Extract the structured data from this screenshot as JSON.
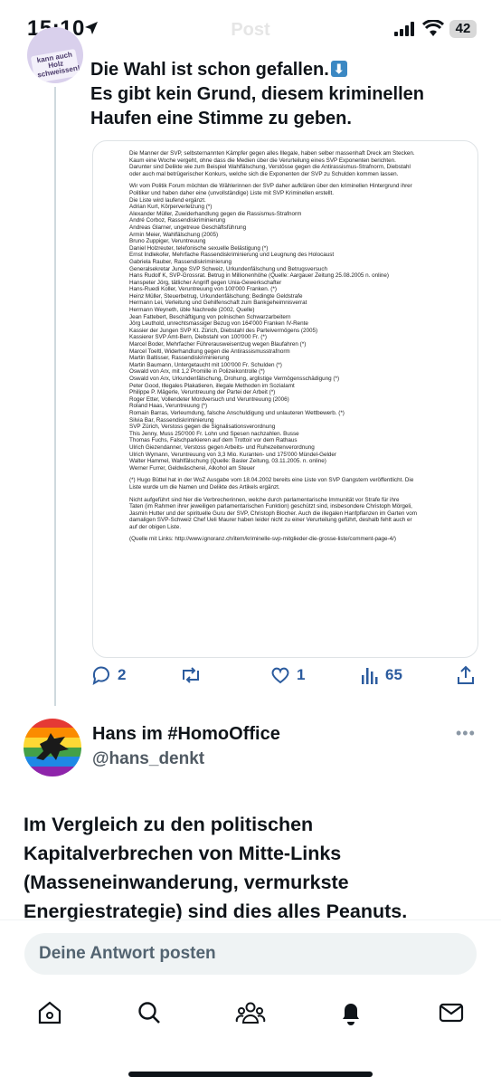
{
  "status_bar": {
    "time": "15:10",
    "battery": "42",
    "ghost_title": "Post"
  },
  "tweet": {
    "avatar_text": "kann auch Holz schweissen!",
    "lines": [
      "Die Wahl ist schon gefallen.",
      "Es gibt kein Grund, diesem kriminellen",
      "Haufen eine Stimme zu geben."
    ],
    "emoji": "⬇",
    "doc_lines": [
      "Die Manner der SVP, selbsternannten Kämpfer gegen alles Illegale, haben selber massenhaft Dreck am Stecken.",
      "Kaum eine Woche vergeht, ohne dass die Medien über die Verurteilung eines SVP Exponenten berichten.",
      "Darunter sind Delikte wie zum Beispiel Wahlfälschung, Verstösse gegen die Antirassismus-Strafnorm, Diebstahl",
      "oder auch mal betrügerischer Konkurs, welche sich die Exponenten der SVP zu Schulden kommen lassen.",
      "",
      "Wir vom Politik Forum möchten die Wählerinnen der SVP daher aufklären über den kriminellen Hintergrund ihrer",
      "Politiker und haben daher eine (unvollständige) Liste mit SVP Kriminellen erstellt.",
      "Die Liste wird laufend ergänzt.",
      "Adrian Kurt, Körperverletzung (*)",
      "Alexander Müller, Zuwiderhandlung gegen die Rassismus-Strafnorm",
      "André Corboz, Rassendiskriminierung",
      "Andreas Glarner, ungetreue Geschäftsführung",
      "Armin Meier, Wahlfälschung (2005)",
      "Bruno Zuppiger, Veruntreuung",
      "Daniel Holzreuter, telefonische sexuelle Belästigung (*)",
      "Ernst Indlekofer, Mehrfache Rassendiskriminierung und Leugnung des Holocaust",
      "Gabriela Rauber, Rassendiskriminierung",
      "Generalsekretar Junge SVP Schweiz, Urkundenfälschung und Betrugsversuch",
      "Hans Rudolf K, SVP-Grossrat. Betrug in Millionenhöhe (Quelle: Aargauer Zeitung 25.08.2005 n. online)",
      "Hanspeter Jörg, tätlicher Angriff gegen Unia-Gewerkschafter",
      "Hans-Ruedi Koller, Veruntreuung von 100'000 Franken. (*)",
      "Heinz Müller, Steuerbetrug, Urkundenfälschung; Bedingte Geldstrafe",
      "Hermann Lei, Verleitung und Gehilfenschaft zum Bankgeheimnisverrat",
      "Hermann Weyneth, üble Nachrede (2002, Quelle)",
      "Jean Fattebert, Beschäftigung von polnischen Schwarzarbeitern",
      "Jörg Leuthold, unrechtsmassiger Bezug von 164'000 Franken IV-Rente",
      "Kassier der Jungen SVP Kt. Zürich, Diebstahl des Parteivermögens (2005)",
      "Kassierer SVP Amt-Bern, Diebstahl von 100'000 Fr. (*)",
      "Marcel Boder, Mehrfacher Führerausweisentzug wegen Blaufahren (*)",
      "Marcel Toeltl, Widerhandlung gegen die Antirassismusstrafnorm",
      "Martin Baltisser, Rassendiskriminierung",
      "Martin Baumann, Untergetaucht mit 100'000 Fr. Schulden (*)",
      "Oswald von Arx, mit 1,2 Promille in Polizeikontrolle (*)",
      "Oswald von Arx, Urkundenfälschung, Drohung, arglistige Vermögensschädigung (*)",
      "Peter Good, Illegales Plakatieren, illegale Methoden im Sozialamt",
      "Philippe P. Mägerle, Veruntreuung der Partei der Arbeit (*)",
      "Roger Etter, Vollendeter Mordversuch und Veruntreuung (2006)",
      "Roland Haas, Veruntreuung (*)",
      "Romain Barras, Verleumdung, falsche Anschuldigung und unlauteren Wettbewerb. (*)",
      "Silvia Bar, Rassendiskriminierung",
      "SVP Zürich, Verstoss gegen die Signalisationsverordnung",
      "This Jenny, Muss 250'000 Fr. Lohn und Spesen nachzahlen. Busse",
      "Thomas Fuchs, Falschparkieren auf dem Trottoir vor dem Rathaus",
      "Ulrich Giezendanner, Verstoss gegen Arbeits- und Ruhezeitenverordnung",
      "Ulrich Wymann, Veruntreuung von 3,3 Mio. Kuranten- und 175'000 Mündel-Gelder",
      "Walter Hammel, Wahlfälschung (Quelle: Basler Zeitung, 03.11.2005. n. online)",
      "Werner Furrer, Geldwäscherei, Alkohol am Steuer",
      "",
      "(*) Hugo Büttel hat in der WoZ Ausgabe vom 18.04.2002 bereits eine Liste von SVP Gangstern veröffentlicht. Die",
      "Liste wurde um die Namen und Delikte des Artikels ergänzt.",
      "",
      "Nicht aufgeführt sind hier die Verbrecherinnen, welche durch parlamentarische Immunität vor Strafe für ihre",
      "Taten (im Rahmen ihrer jeweiligen parlamentarischen Funktion) geschützt sind, insbesondere Christoph Mörgeli,",
      "Jasmin Hutter und der spirituelle Guru der SVP, Christoph Blocher. Auch die illegalen Hanfpflanzen im Garten vom",
      "damaligen SVP-Schweiz Chef Ueli Maurer haben leider nicht zu einer Verurteilung geführt, deshalb fehlt auch er",
      "auf der obigen Liste.",
      "",
      "(Quelle mit Links: http://www.ignoranz.ch/item/kriminelle-svp-mitglieder-die-grosse-liste/comment-page-4/)"
    ],
    "actions": {
      "replies": "2",
      "likes": "1",
      "views": "65"
    }
  },
  "reply": {
    "name": "Hans im #HomoOffice",
    "handle": "@hans_denkt",
    "more": "•••",
    "text_lines": [
      "Im Vergleich zu den politischen",
      "Kapitalverbrechen von Mitte-Links",
      "(Masseneinwanderung, vermurkste",
      "Energiestrategie) sind dies alles Peanuts."
    ]
  },
  "composer": {
    "placeholder": "Deine Antwort posten"
  },
  "tabbar": {
    "icons": [
      "home-icon",
      "search-icon",
      "communities-icon",
      "notifications-icon",
      "messages-icon"
    ]
  },
  "colors": {
    "accent": "#1d9bf0",
    "action_text": "#2b5b9e",
    "muted": "#536471"
  }
}
